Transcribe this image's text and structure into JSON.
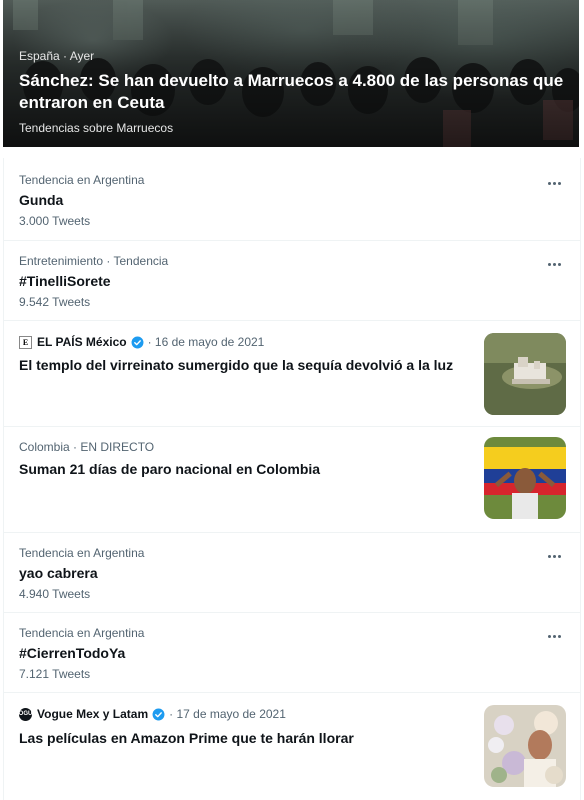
{
  "hero": {
    "meta": "España · Ayer",
    "title": "Sánchez: Se han devuelto a Marruecos a 4.800 de las personas que entraron en Ceuta",
    "subtitle": "Tendencias sobre Marruecos"
  },
  "trends": [
    {
      "category": "Tendencia en Argentina",
      "name": "Gunda",
      "count": "3.000 Tweets"
    },
    {
      "category": "Entretenimiento · Tendencia",
      "name": "#TinelliSorete",
      "count": "9.542 Tweets"
    },
    {
      "category": "Tendencia en Argentina",
      "name": "yao cabrera",
      "count": "4.940 Tweets"
    },
    {
      "category": "Tendencia en Argentina",
      "name": "#CierrenTodoYa",
      "count": "7.121 Tweets"
    }
  ],
  "news": [
    {
      "outlet": "EL PAÍS México",
      "logo": "E",
      "date": "· 16 de mayo de 2021",
      "headline": "El templo del virreinato sumergido que la sequía devolvió a la luz"
    },
    {
      "meta": "Colombia · EN DIRECTO",
      "headline": "Suman 21 días de paro nacional en Colombia"
    },
    {
      "outlet": "Vogue Mex y Latam",
      "logo": "VOGUE",
      "date": "· 17 de mayo de 2021",
      "headline": "Las películas en Amazon Prime que te harán llorar"
    }
  ],
  "colors": {
    "verified": "#1d9bf0",
    "secondary_text": "#536471",
    "primary_text": "#0f1419"
  }
}
